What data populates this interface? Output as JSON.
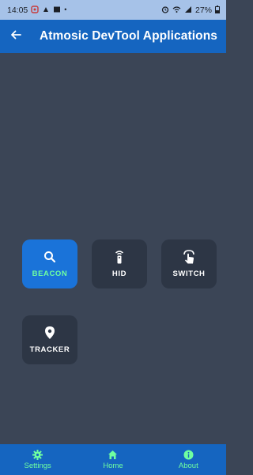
{
  "status_bar": {
    "time": "14:05",
    "battery": "27%",
    "left_icons": [
      "notification-icon",
      "app-icon",
      "image-icon",
      "dot"
    ],
    "right_icons": [
      "alarm-icon",
      "wifi-icon",
      "signal-icon",
      "battery-icon"
    ]
  },
  "app_bar": {
    "back_icon": "arrow-left-icon",
    "title": "Atmosic DevTool Applications"
  },
  "tiles": [
    {
      "label": "BEACON",
      "icon": "search-icon",
      "active": true
    },
    {
      "label": "HID",
      "icon": "remote-icon",
      "active": false
    },
    {
      "label": "SWITCH",
      "icon": "touch-icon",
      "active": false
    },
    {
      "label": "TRACKER",
      "icon": "location-pin-icon",
      "active": false
    }
  ],
  "bottom_nav": {
    "items": [
      {
        "label": "Settings",
        "icon": "gear-icon"
      },
      {
        "label": "Home",
        "icon": "home-icon"
      },
      {
        "label": "About",
        "icon": "info-icon"
      }
    ]
  },
  "colors": {
    "status_bar": "#a6c2e8",
    "app_bar": "#1565c0",
    "background": "#3b4556",
    "tile": "#2d3645",
    "tile_active": "#1a73d9",
    "accent_text": "#6fffa0"
  }
}
